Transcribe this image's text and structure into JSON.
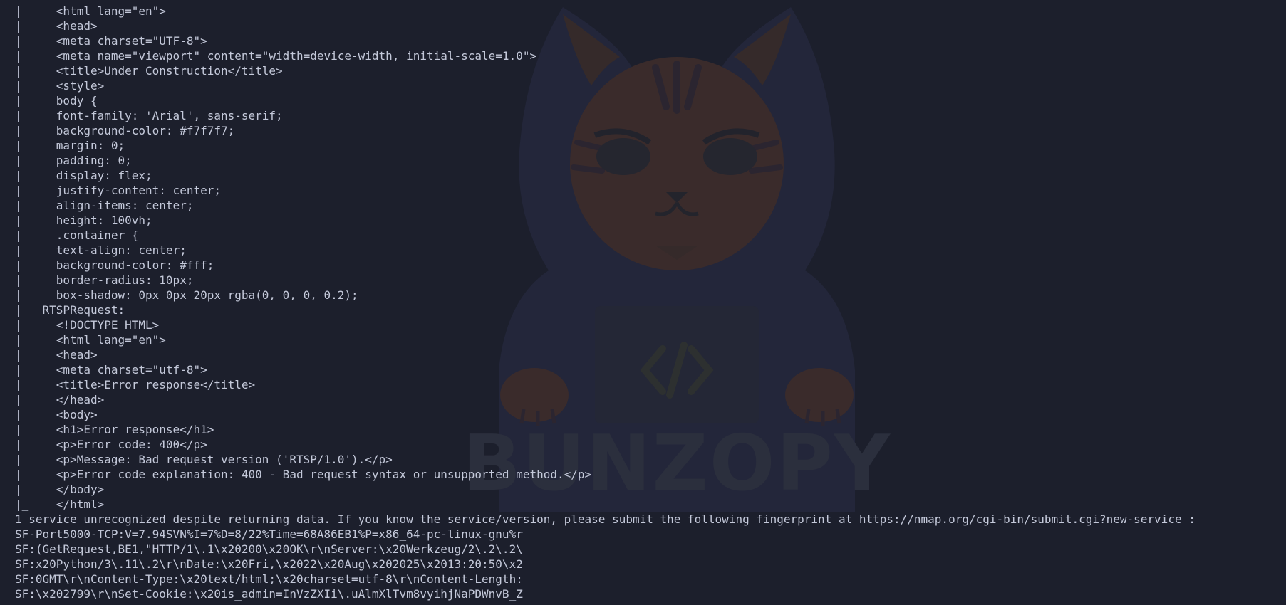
{
  "wallpaper": {
    "brand_text": "BUNZOPY",
    "icon": "hooded-cat-coder-icon"
  },
  "terminal": {
    "lines": [
      "|     <html lang=\"en\">",
      "|     <head>",
      "|     <meta charset=\"UTF-8\">",
      "|     <meta name=\"viewport\" content=\"width=device-width, initial-scale=1.0\">",
      "|     <title>Under Construction</title>",
      "|     <style>",
      "|     body {",
      "|     font-family: 'Arial', sans-serif;",
      "|     background-color: #f7f7f7;",
      "|     margin: 0;",
      "|     padding: 0;",
      "|     display: flex;",
      "|     justify-content: center;",
      "|     align-items: center;",
      "|     height: 100vh;",
      "|     .container {",
      "|     text-align: center;",
      "|     background-color: #fff;",
      "|     border-radius: 10px;",
      "|     box-shadow: 0px 0px 20px rgba(0, 0, 0, 0.2);",
      "|   RTSPRequest:",
      "|     <!DOCTYPE HTML>",
      "|     <html lang=\"en\">",
      "|     <head>",
      "|     <meta charset=\"utf-8\">",
      "|     <title>Error response</title>",
      "|     </head>",
      "|     <body>",
      "|     <h1>Error response</h1>",
      "|     <p>Error code: 400</p>",
      "|     <p>Message: Bad request version ('RTSP/1.0').</p>",
      "|     <p>Error code explanation: 400 - Bad request syntax or unsupported method.</p>",
      "|     </body>",
      "|_    </html>",
      "1 service unrecognized despite returning data. If you know the service/version, please submit the following fingerprint at https://nmap.org/cgi-bin/submit.cgi?new-service :",
      "SF-Port5000-TCP:V=7.94SVN%I=7%D=8/22%Time=68A86EB1%P=x86_64-pc-linux-gnu%r",
      "SF:(GetRequest,BE1,\"HTTP/1\\.1\\x20200\\x20OK\\r\\nServer:\\x20Werkzeug/2\\.2\\.2\\",
      "SF:x20Python/3\\.11\\.2\\r\\nDate:\\x20Fri,\\x2022\\x20Aug\\x202025\\x2013:20:50\\x2",
      "SF:0GMT\\r\\nContent-Type:\\x20text/html;\\x20charset=utf-8\\r\\nContent-Length:",
      "SF:\\x202799\\r\\nSet-Cookie:\\x20is_admin=InVzZXIi\\.uAlmXlTvm8vyihjNaPDWnvB_Z"
    ]
  }
}
